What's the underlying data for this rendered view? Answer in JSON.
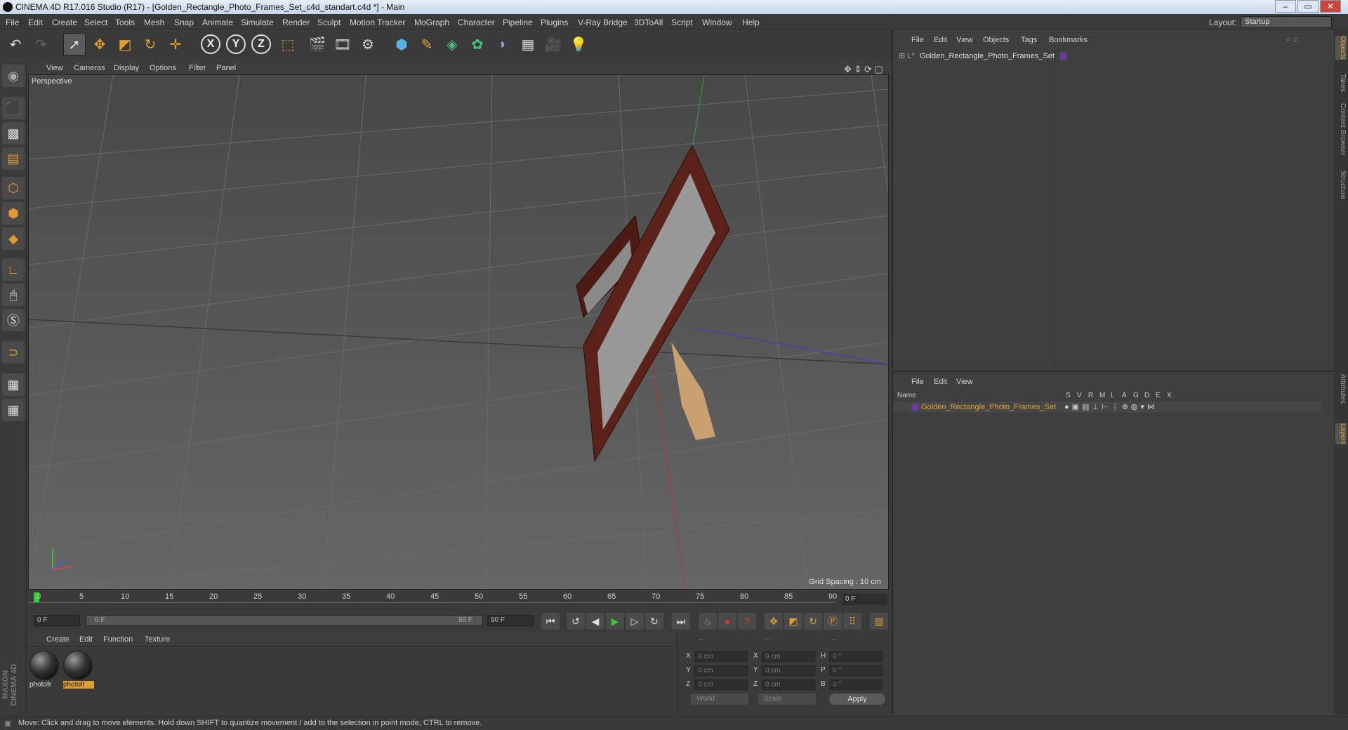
{
  "window": {
    "title": "CINEMA 4D R17.016 Studio (R17) - [Golden_Rectangle_Photo_Frames_Set_c4d_standart.c4d *] - Main",
    "controls": [
      "–",
      "▭",
      "✕"
    ]
  },
  "menubar": {
    "items": [
      "File",
      "Edit",
      "Create",
      "Select",
      "Tools",
      "Mesh",
      "Snap",
      "Animate",
      "Simulate",
      "Render",
      "Sculpt",
      "Motion Tracker",
      "MoGraph",
      "Character",
      "Pipeline",
      "Plugins",
      "V-Ray Bridge",
      "3DToAll",
      "Script",
      "Window",
      "Help"
    ],
    "layout_label": "Layout:",
    "layout_value": "Startup"
  },
  "viewport": {
    "menu": [
      "View",
      "Cameras",
      "Display",
      "Options",
      "Filter",
      "Panel"
    ],
    "label": "Perspective",
    "grid_spacing": "Grid Spacing : 10 cm"
  },
  "timeline": {
    "ticks": [
      "0",
      "5",
      "10",
      "15",
      "20",
      "25",
      "30",
      "35",
      "40",
      "45",
      "50",
      "55",
      "60",
      "65",
      "70",
      "75",
      "80",
      "85",
      "90"
    ],
    "current_frame": "0 F",
    "start_field": "0 F",
    "range_start": "0 F",
    "range_end": "90 F",
    "end_field": "90 F"
  },
  "materials": {
    "menu": [
      "Create",
      "Edit",
      "Function",
      "Texture"
    ],
    "items": [
      {
        "name": "photofr",
        "active": false
      },
      {
        "name": "photofr",
        "active": true
      }
    ]
  },
  "coordinates": {
    "header": [
      "--",
      "--",
      "--"
    ],
    "rows": [
      {
        "a": "X",
        "av": "0 cm",
        "b": "X",
        "bv": "0 cm",
        "c": "H",
        "cv": "0 °"
      },
      {
        "a": "Y",
        "av": "0 cm",
        "b": "Y",
        "bv": "0 cm",
        "c": "P",
        "cv": "0 °"
      },
      {
        "a": "Z",
        "av": "0 cm",
        "b": "Z",
        "bv": "0 cm",
        "c": "B",
        "cv": "0 °"
      }
    ],
    "space": "World",
    "mode": "Scale",
    "apply": "Apply"
  },
  "objects_panel": {
    "menu": [
      "File",
      "Edit",
      "View",
      "Objects",
      "Tags",
      "Bookmarks"
    ],
    "object_name": "Golden_Rectangle_Photo_Frames_Set"
  },
  "layers_panel": {
    "menu": [
      "File",
      "Edit",
      "View"
    ],
    "name_header": "Name",
    "columns": [
      "S",
      "V",
      "R",
      "M",
      "L",
      "A",
      "G",
      "D",
      "E",
      "X"
    ],
    "layer_name": "Golden_Rectangle_Photo_Frames_Set"
  },
  "side_tabs": [
    "Objects",
    "Takes",
    "Content Browser",
    "Structure",
    "Attributes",
    "Layers"
  ],
  "status": "Move: Click and drag to move elements. Hold down SHIFT to quantize movement / add to the selection in point mode, CTRL to remove.",
  "branding": "MAXON CINEMA 4D"
}
